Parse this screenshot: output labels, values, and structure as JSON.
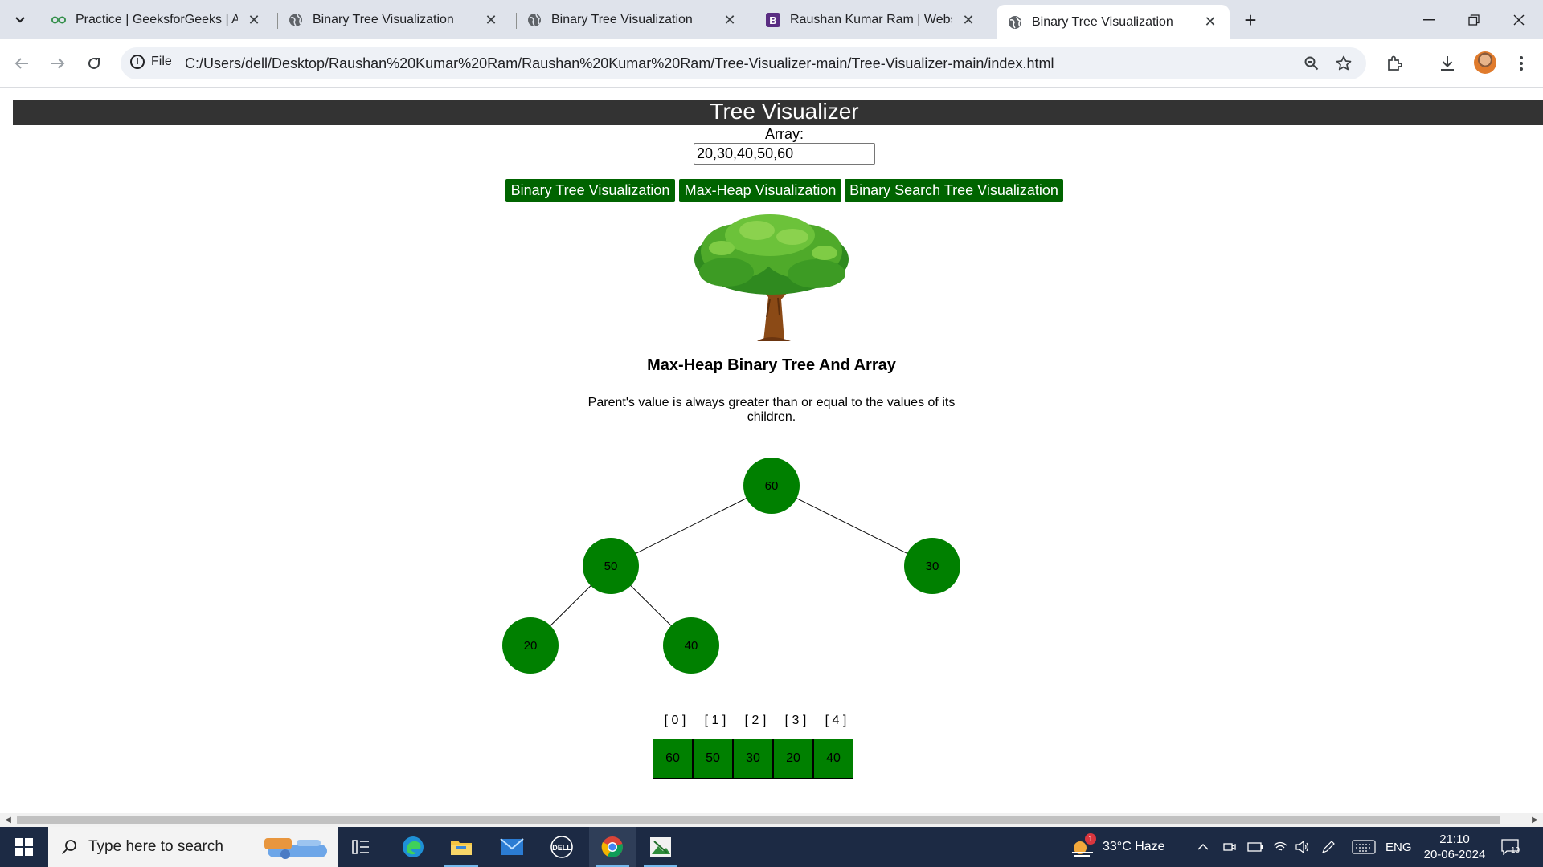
{
  "browser": {
    "tabs": [
      {
        "title": "Practice | GeeksforGeeks | A co",
        "icon": "gfg-icon",
        "active": false
      },
      {
        "title": "Binary Tree Visualization",
        "icon": "globe-icon",
        "active": false
      },
      {
        "title": "Binary Tree Visualization",
        "icon": "globe-icon",
        "active": false
      },
      {
        "title": "Raushan Kumar Ram | Website",
        "icon": "b-icon",
        "active": false
      },
      {
        "title": "Binary Tree Visualization",
        "icon": "globe-icon",
        "active": true
      }
    ],
    "address": {
      "scheme_label": "File",
      "url": "C:/Users/dell/Desktop/Raushan%20Kumar%20Ram/Raushan%20Kumar%20Ram/Tree-Visualizer-main/Tree-Visualizer-main/index.html"
    }
  },
  "page": {
    "header_title": "Tree Visualizer",
    "array_label": "Array:",
    "array_value": "20,30,40,50,60",
    "buttons": {
      "binary_tree": "Binary Tree Visualization",
      "max_heap": "Max-Heap Visualization",
      "bst": "Binary Search Tree Visualization"
    },
    "section_title": "Max-Heap Binary Tree And Array",
    "section_description": "Parent's value is always greater than or equal to the values of its children.",
    "tree_nodes": [
      "60",
      "50",
      "30",
      "20",
      "40"
    ],
    "array_indices": [
      "[ 0 ]",
      "[ 1 ]",
      "[ 2 ]",
      "[ 3 ]",
      "[ 4 ]"
    ],
    "array_values": [
      "60",
      "50",
      "30",
      "20",
      "40"
    ],
    "colors": {
      "header_bg": "#333333",
      "button_bg": "#006400",
      "node_fill": "#008000"
    }
  },
  "taskbar": {
    "search_placeholder": "Type here to search",
    "weather": "33°C  Haze",
    "weather_badge": "1",
    "language": "ENG",
    "time": "21:10",
    "date": "20-06-2024",
    "notifications": "10"
  }
}
